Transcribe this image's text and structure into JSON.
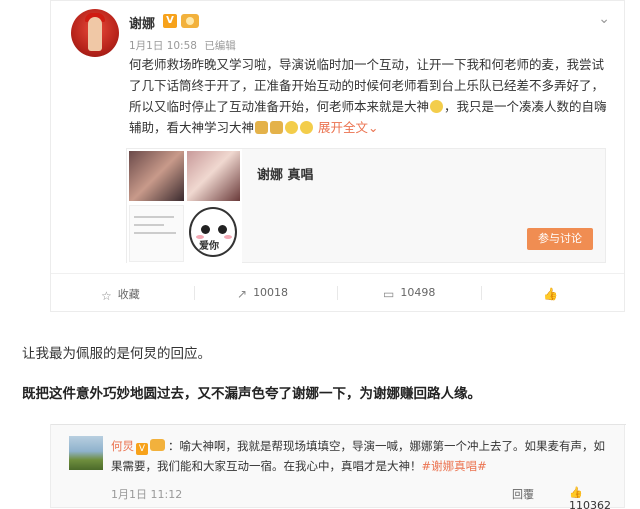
{
  "post": {
    "username": "谢娜",
    "v_badge": "V",
    "menu_icon": "chevron-down-icon",
    "date": "1月1日 10:58",
    "source": "已编辑",
    "text": "何老师救场昨晚又学习啦，导演说临时加一个互动，让开一下我和何老师的麦，我尝试了几下话筒终于开了，正准备开始互动的时候何老师看到台上乐队已经差不多弄好了，所以又临时停止了互动准备开始，何老师本来就是大神",
    "text_2": "，我只是一个凑凑人数的自嗨辅助，看大神学习大神",
    "expand_label": "展开全文",
    "expand_arrow": "⌄"
  },
  "link_card": {
    "title": "谢娜 真唱",
    "face_text": "爱你",
    "button_label": "参与讨论"
  },
  "actions": {
    "favorite_label": "收藏",
    "favorite_icon": "star-icon",
    "repost_count": "10018",
    "repost_icon": "repost-icon",
    "comment_count": "10498",
    "comment_icon": "comment-icon",
    "like_icon": "thumbs-up-icon"
  },
  "article": {
    "para1": "让我最为佩服的是何炅的回应。",
    "para2": "既把这件意外巧妙地圆过去，又不漏声色夸了谢娜一下，为谢娜赚回路人缘。"
  },
  "comment": {
    "name": "何炅",
    "v_badge": "V",
    "text": "：喻大神啊，我就是帮现场填填空，导演一喊，娜娜第一个冲上去了。如果麦有声，如果需要，我们能和大家互动一宿。在我心中，真唱才是大神！",
    "tag": "#谢娜真唱#",
    "time": "1月1日 11:12",
    "reply_label": "回覆",
    "like_count": "110362",
    "like_icon": "thumbs-up-icon"
  },
  "colors": {
    "accent": "#eb7350",
    "button": "#f08d52",
    "vip_badge": "#f7a21b"
  }
}
